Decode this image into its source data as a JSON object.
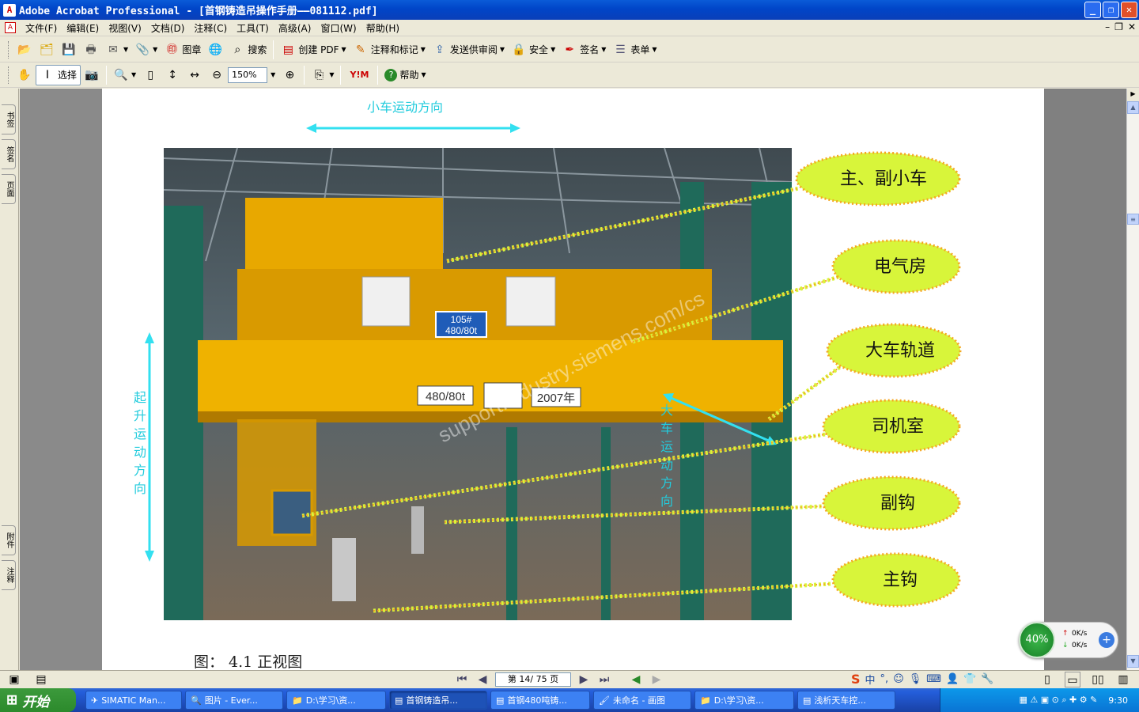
{
  "window": {
    "title": "Adobe Acrobat Professional - [首钢铸造吊操作手册——081112.pdf]"
  },
  "menu": [
    "文件(F)",
    "编辑(E)",
    "视图(V)",
    "文档(D)",
    "注释(C)",
    "工具(T)",
    "高级(A)",
    "窗口(W)",
    "帮助(H)"
  ],
  "toolbar1": {
    "stamp": "图章",
    "search": "搜索",
    "create_pdf": "创建 PDF",
    "comment": "注释和标记",
    "send_review": "发送供审阅",
    "security": "安全",
    "sign": "签名",
    "forms": "表单"
  },
  "toolbar2": {
    "select": "选择",
    "zoom": "150%",
    "help": "帮助"
  },
  "sidetabs": [
    "书签",
    "签名",
    "页面",
    "附件",
    "注释"
  ],
  "figure": {
    "trolley_dir": "小车运动方向",
    "hoist_dir": "起升运动方向",
    "bridge_dir": "大车运动方向",
    "caption": "图： 4.1 正视图",
    "labels": [
      "主、副小车",
      "电气房",
      "大车轨道",
      "司机室",
      "副钩",
      "主钩"
    ],
    "crane_plate": "105#\n480/80t",
    "girder_rating": "480/80t",
    "girder_year": "2007年",
    "watermark": "support.industry.siemens.com/cs"
  },
  "status": {
    "page": "第 14/ 75 页"
  },
  "net": {
    "percent": "40%",
    "up": "0K/s",
    "down": "0K/s"
  },
  "taskbar": {
    "start": "开始",
    "tasks": [
      "SIMATIC Man...",
      "图片 - Ever...",
      "D:\\学习\\资...",
      "首钢铸造吊...",
      "首钢480吨铸...",
      "未命名 - 画图",
      "D:\\学习\\资...",
      "浅析天车控..."
    ],
    "active": 3,
    "clock": "9:30"
  },
  "colors": {
    "label_fill": "#d8f53a",
    "label_border": "#f5a623",
    "arrow": "#33e0f0",
    "crane": "#e8a800"
  }
}
